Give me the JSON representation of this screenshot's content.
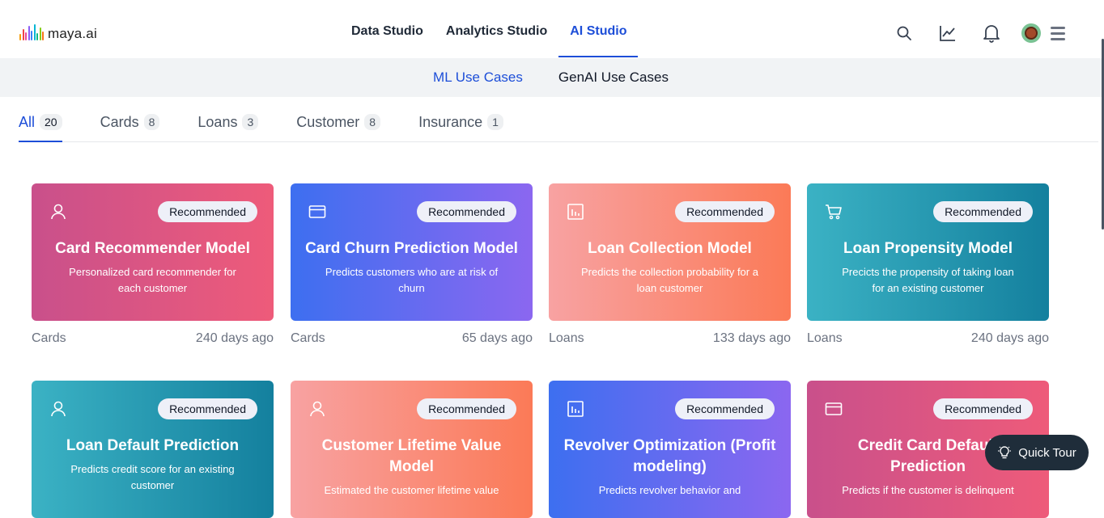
{
  "logo": {
    "text": "maya.ai"
  },
  "topnav": {
    "items": [
      {
        "label": "Data Studio",
        "active": false
      },
      {
        "label": "Analytics Studio",
        "active": false
      },
      {
        "label": "AI Studio",
        "active": true
      }
    ]
  },
  "header_icons": [
    "search-icon",
    "chart-line-icon",
    "bell-icon",
    "avatar",
    "hamburger-menu-icon"
  ],
  "subnav": {
    "items": [
      {
        "label": "ML Use Cases",
        "active": true
      },
      {
        "label": "GenAI Use Cases",
        "active": false
      }
    ]
  },
  "tabs": [
    {
      "label": "All",
      "count": "20",
      "active": true
    },
    {
      "label": "Cards",
      "count": "8",
      "active": false
    },
    {
      "label": "Loans",
      "count": "3",
      "active": false
    },
    {
      "label": "Customer",
      "count": "8",
      "active": false
    },
    {
      "label": "Insurance",
      "count": "1",
      "active": false
    }
  ],
  "cards": [
    {
      "icon": "user-icon",
      "badge": "Recommended",
      "title": "Card Recommender Model",
      "description": "Personalized card recommender for each customer",
      "category": "Cards",
      "age": "240 days ago",
      "gradient": "pinkred"
    },
    {
      "icon": "credit-card-icon",
      "badge": "Recommended",
      "title": "Card Churn Prediction Model",
      "description": "Predicts customers who are at risk of churn",
      "category": "Cards",
      "age": "65 days ago",
      "gradient": "bluepurp"
    },
    {
      "icon": "bar-chart-icon",
      "badge": "Recommended",
      "title": "Loan Collection Model",
      "description": "Predicts the collection probability for a loan customer",
      "category": "Loans",
      "age": "133 days ago",
      "gradient": "salmon"
    },
    {
      "icon": "shopping-cart-icon",
      "badge": "Recommended",
      "title": "Loan Propensity Model",
      "description": "Precicts the propensity of taking loan for an existing customer",
      "category": "Loans",
      "age": "240 days ago",
      "gradient": "teal"
    },
    {
      "icon": "user-icon",
      "badge": "Recommended",
      "title": "Loan Default Prediction",
      "description": "Predicts credit score for an existing customer",
      "category": "",
      "age": "",
      "gradient": "teal"
    },
    {
      "icon": "user-icon",
      "badge": "Recommended",
      "title": "Customer Lifetime Value Model",
      "description": "Estimated the customer lifetime value",
      "category": "",
      "age": "",
      "gradient": "salmon"
    },
    {
      "icon": "bar-chart-icon",
      "badge": "Recommended",
      "title": "Revolver Optimization (Profit modeling)",
      "description": "Predicts revolver behavior and",
      "category": "",
      "age": "",
      "gradient": "bluepurp"
    },
    {
      "icon": "credit-card-icon",
      "badge": "Recommended",
      "title": "Credit Card Default Prediction",
      "description": "Predicts if the customer is delinquent",
      "category": "",
      "age": "",
      "gradient": "pinkred"
    }
  ],
  "quick_tour": {
    "label": "Quick Tour",
    "icon": "lightbulb-icon"
  },
  "colors": {
    "accent": "#1d4ed8",
    "quick_tour_bg": "#1f2d3a"
  }
}
